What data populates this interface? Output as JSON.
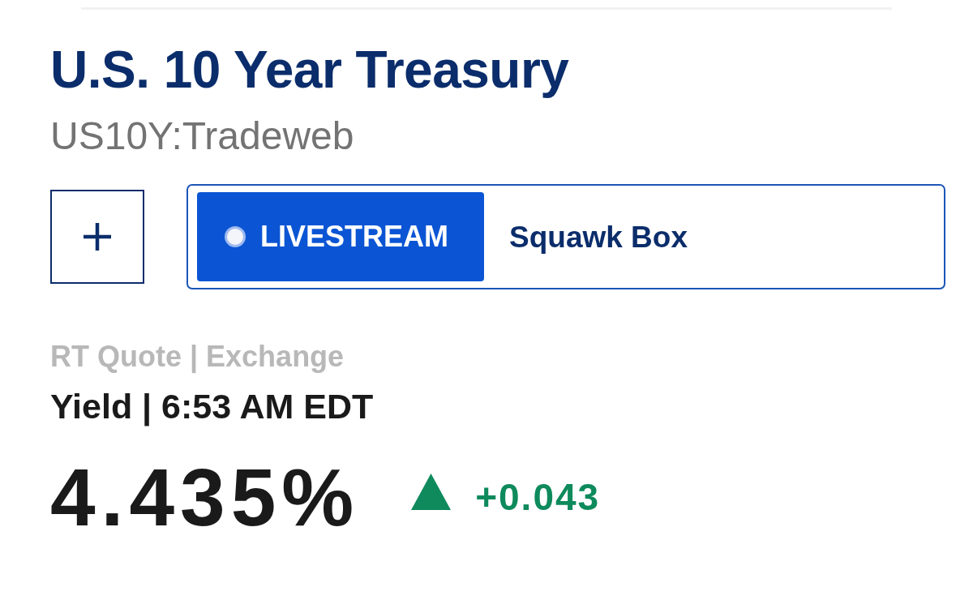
{
  "header": {
    "title": "U.S. 10 Year Treasury",
    "symbol": "US10Y:Tradeweb"
  },
  "livestream": {
    "label": "LIVESTREAM",
    "show": "Squawk Box"
  },
  "quote": {
    "source": "RT Quote | Exchange",
    "type_time": "Yield | 6:53 AM EDT",
    "value": "4.435%",
    "rising": true,
    "change": "+0.043"
  }
}
